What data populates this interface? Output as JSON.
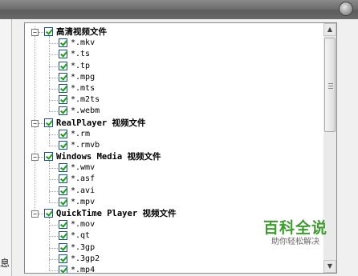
{
  "tree": {
    "groups": [
      {
        "label": "高清视频文件",
        "checked": true,
        "expanded": true,
        "items": [
          "*.mkv",
          "*.ts",
          "*.tp",
          "*.mpg",
          "*.mts",
          "*.m2ts",
          "*.webm"
        ]
      },
      {
        "label": "RealPlayer 视频文件",
        "checked": true,
        "expanded": true,
        "items": [
          "*.rm",
          "*.rmvb"
        ]
      },
      {
        "label": "Windows Media 视频文件",
        "checked": true,
        "expanded": true,
        "items": [
          "*.wmv",
          "*.asf",
          "*.avi",
          "*.mpv"
        ]
      },
      {
        "label": "QuickTime Player 视频文件",
        "checked": true,
        "expanded": true,
        "items": [
          "*.mov",
          "*.qt",
          "*.3gp",
          "*.3gp2",
          "*.mp4"
        ]
      }
    ]
  },
  "left_glyph": "息",
  "watermark": {
    "title": "百科全说",
    "subtitle": "助你轻松解决"
  },
  "icons": {
    "expander": "minus-expander-icon",
    "checkbox": "checkmark-icon",
    "scroll_up": "arrow-up-icon",
    "scroll_down": "arrow-down-icon"
  },
  "colors": {
    "check": "#18a018",
    "checkbox_border": "#1c5180",
    "watermark": "#3f9a2f"
  }
}
